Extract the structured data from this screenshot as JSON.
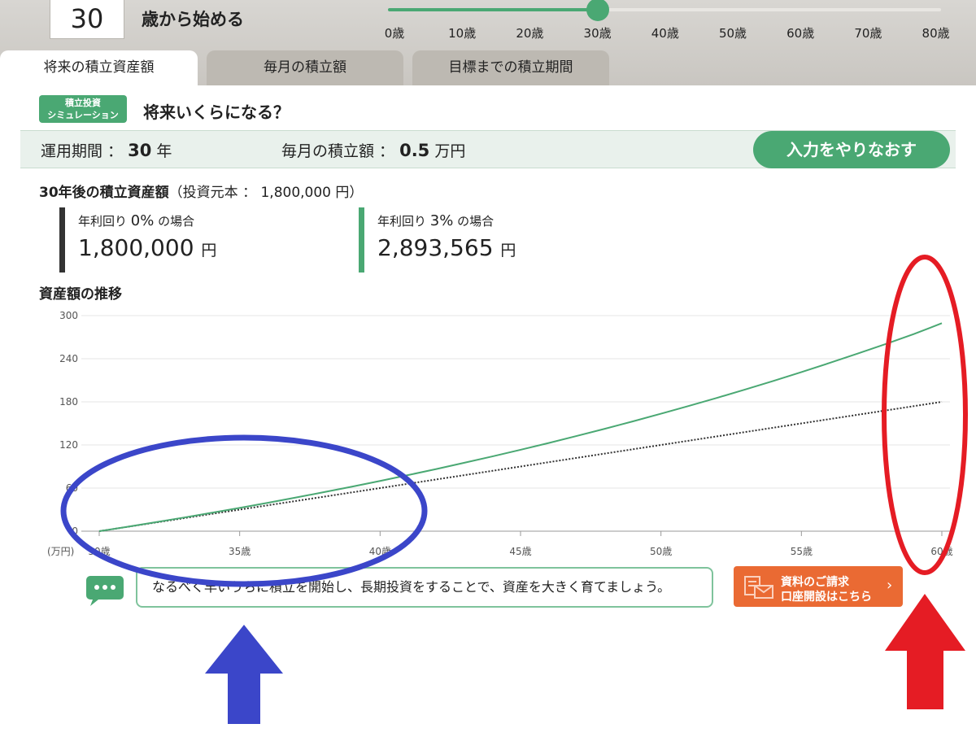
{
  "slider": {
    "age_value": "30",
    "age_suffix": "歳から始める",
    "selected_age": 30,
    "ticks": [
      "0歳",
      "10歳",
      "20歳",
      "30歳",
      "40歳",
      "50歳",
      "60歳",
      "70歳",
      "80歳"
    ],
    "accent_color": "#4aa873"
  },
  "tabs": [
    {
      "label": "将来の積立資産額",
      "active": true
    },
    {
      "label": "毎月の積立額",
      "active": false
    },
    {
      "label": "目標までの積立期間",
      "active": false
    }
  ],
  "heading": {
    "badge_line1": "積立投資",
    "badge_line2": "シミュレーション",
    "title": "将来いくらになる？"
  },
  "summary": {
    "period_label": "運用期間 ：",
    "period_value": "30",
    "period_unit": "年",
    "monthly_label": "毎月の積立額 ：",
    "monthly_value": "0.5",
    "monthly_unit": "万円",
    "redo_label": "入力をやりなおす"
  },
  "results": {
    "heading_bold": "30年後の積立資産額",
    "heading_rest": "（投資元本 ： 1,800,000 円）",
    "cards": [
      {
        "label_pre": "年利回り ",
        "pct": "0%",
        "label_post": " の場合",
        "value": "1,800,000",
        "unit": "円",
        "color": "#333333"
      },
      {
        "label_pre": "年利回り ",
        "pct": "3%",
        "label_post": " の場合",
        "value": "2,893,565",
        "unit": "円",
        "color": "#4aa873"
      }
    ]
  },
  "chart_title": "資産額の推移",
  "chart_data": {
    "type": "line",
    "x": [
      30,
      31,
      32,
      33,
      34,
      35,
      36,
      37,
      38,
      39,
      40,
      41,
      42,
      43,
      44,
      45,
      46,
      47,
      48,
      49,
      50,
      51,
      52,
      53,
      54,
      55,
      56,
      57,
      58,
      59,
      60
    ],
    "xlim": [
      30,
      60
    ],
    "xticks": [
      "30歳",
      "35歳",
      "40歳",
      "45歳",
      "50歳",
      "55歳",
      "60歳"
    ],
    "ylim": [
      0,
      300
    ],
    "yticks": [
      "0",
      "60",
      "120",
      "180",
      "240",
      "300"
    ],
    "yunit": "(万円)",
    "grid": true,
    "series": [
      {
        "values": [
          0,
          6,
          12,
          18,
          24,
          30,
          36,
          42,
          48,
          54,
          60,
          66,
          72,
          78,
          84,
          90,
          96,
          102,
          108,
          114,
          120,
          126,
          132,
          138,
          144,
          150,
          156,
          162,
          168,
          174,
          180
        ],
        "color": "#333333",
        "style": "dotted"
      },
      {
        "values": [
          0,
          6.1,
          12.4,
          18.9,
          25.6,
          32.4,
          39.5,
          46.8,
          54.3,
          62.0,
          69.9,
          78.1,
          86.5,
          95.2,
          104.1,
          113.3,
          122.7,
          132.5,
          142.5,
          152.8,
          163.5,
          174.4,
          185.6,
          197.2,
          209.1,
          221.4,
          234.1,
          247.1,
          260.5,
          274.3,
          289.4
        ],
        "color": "#4aa873",
        "style": "solid"
      }
    ]
  },
  "message": "なるべく早いうちに積立を開始し、長期投資をすることで、資産を大きく育てましょう。",
  "cta": {
    "line1": "資料のご請求",
    "line2": "口座開設はこちら",
    "chevron": "›"
  },
  "annotations": {
    "blue": "#3b46c9",
    "red": "#e51c24"
  }
}
